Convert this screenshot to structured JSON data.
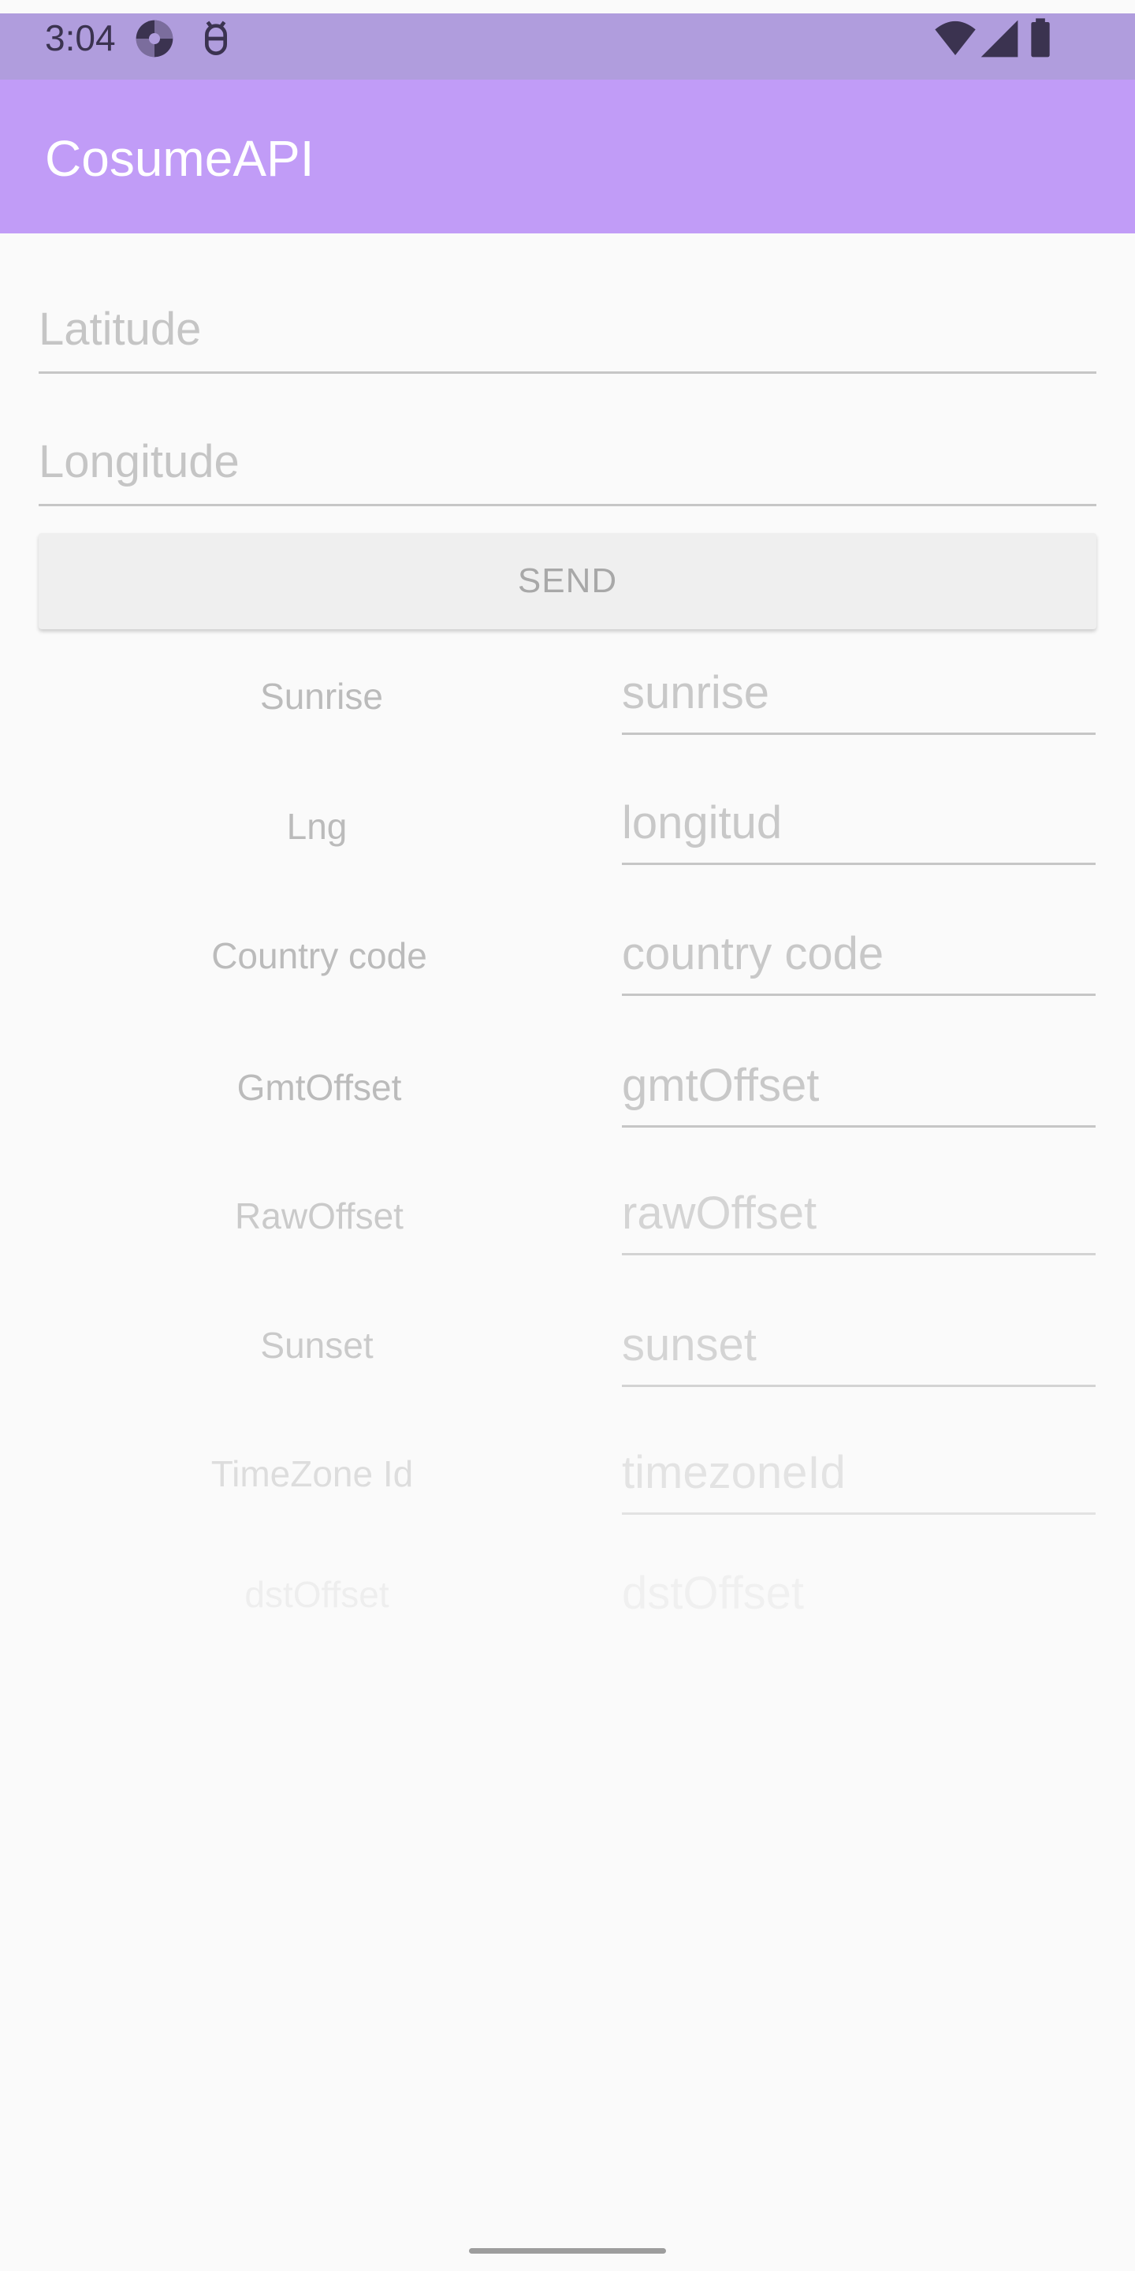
{
  "status_bar": {
    "time": "3:04",
    "left_icons": [
      "pinwheel-app-icon",
      "android-debug-icon"
    ],
    "right_icons": [
      "wifi-icon",
      "cellular-signal-icon",
      "battery-icon"
    ]
  },
  "app_bar": {
    "title": "CosumeAPI"
  },
  "inputs": {
    "latitude": {
      "value": "",
      "placeholder": "Latitude"
    },
    "longitude": {
      "value": "",
      "placeholder": "Longitude"
    }
  },
  "send_button": {
    "label": "SEND"
  },
  "results": [
    {
      "label": "Sunrise",
      "placeholder": "sunrise",
      "value": ""
    },
    {
      "label": "Lng",
      "placeholder": "longitud",
      "value": ""
    },
    {
      "label": "Country code",
      "placeholder": "country code",
      "value": ""
    },
    {
      "label": "GmtOffset",
      "placeholder": "gmtOffset",
      "value": ""
    },
    {
      "label": "RawOffset",
      "placeholder": "rawOffset",
      "value": ""
    },
    {
      "label": "Sunset",
      "placeholder": "sunset",
      "value": ""
    },
    {
      "label": "TimeZone Id",
      "placeholder": "timezoneId",
      "value": ""
    },
    {
      "label": "dstOffset",
      "placeholder": "dstOffset",
      "value": ""
    }
  ],
  "colors": {
    "status_bar": "#b09ddd",
    "app_bar": "#c19cf7",
    "background": "#fafafa",
    "button": "#efefef"
  }
}
